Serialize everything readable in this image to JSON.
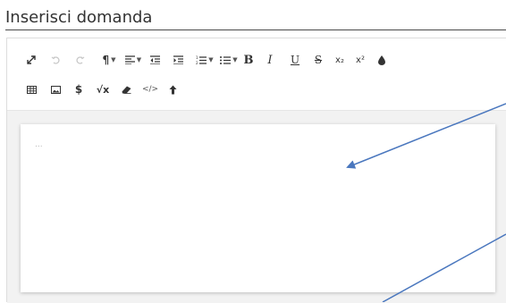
{
  "title": "Inserisci domanda",
  "editor": {
    "placeholder": "...",
    "toolbar_row1": [
      {
        "icon": "fullscreen-icon",
        "glyph": "⤢"
      },
      {
        "icon": "undo-icon",
        "glyph": "↶"
      },
      {
        "icon": "redo-icon",
        "glyph": "↷"
      },
      {
        "icon": "paragraph-style-icon",
        "glyph": "¶"
      },
      {
        "icon": "align-icon",
        "glyph": "≡"
      },
      {
        "icon": "outdent-icon",
        "glyph": ""
      },
      {
        "icon": "indent-icon",
        "glyph": ""
      },
      {
        "icon": "ordered-list-icon",
        "glyph": ""
      },
      {
        "icon": "unordered-list-icon",
        "glyph": ""
      },
      {
        "icon": "bold-icon",
        "glyph": "B"
      },
      {
        "icon": "italic-icon",
        "glyph": "I"
      },
      {
        "icon": "underline-icon",
        "glyph": "U"
      },
      {
        "icon": "strikethrough-icon",
        "glyph": "S"
      },
      {
        "icon": "subscript-icon",
        "glyph": "x₂"
      },
      {
        "icon": "superscript-icon",
        "glyph": "x²"
      },
      {
        "icon": "text-color-icon",
        "glyph": "💧"
      }
    ],
    "toolbar_row2": [
      {
        "icon": "table-icon",
        "glyph": ""
      },
      {
        "icon": "image-icon",
        "glyph": ""
      },
      {
        "icon": "dollar-icon",
        "glyph": "$"
      },
      {
        "icon": "formula-icon",
        "glyph": "√x"
      },
      {
        "icon": "eraser-icon",
        "glyph": ""
      },
      {
        "icon": "code-view-icon",
        "glyph": "</>"
      },
      {
        "icon": "upload-arrow-icon",
        "glyph": "🡑"
      }
    ]
  },
  "colors": {
    "arrow": "#4a77be",
    "title_text": "#333333",
    "editor_background": "#f2f2f2"
  }
}
